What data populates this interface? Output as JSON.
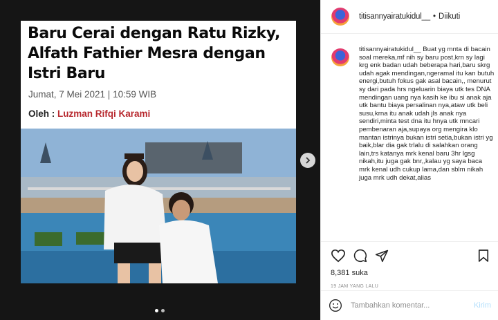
{
  "post": {
    "article": {
      "headline": "Baru Cerai dengan Ratu Rizky, Alfath Fathier Mesra dengan Istri Baru",
      "date": "Jumat, 7 Mei 2021 | 10:59 WIB",
      "byline_label": "Oleh :",
      "byline_author": "Luzman Rifqi Karami",
      "author_color": "#b7282e"
    },
    "carousel": {
      "current": 1,
      "total": 2
    }
  },
  "header": {
    "username": "titisannyairatukidul__",
    "separator": "•",
    "follow_status": "Diikuti"
  },
  "caption": {
    "username": "titisannyairatukidul__",
    "text": "Buat yg mnta di bacain soal mereka,mf nih sy baru post,krn sy lagi krg enk badan udah beberapa hari,baru skrg udah agak mendingan,ngeramal itu kan butuh energi,butuh fokus gak asal bacain,, menurut sy dari pada hrs ngeluarin biaya utk tes DNA mendingan uang nya kasih ke ibu si anak aja utk bantu biaya persalinan nya,ataw utk beli susu,krna itu anak udah jls anak nya sendiri,minta test dna itu hnya utk mncari pembenaran aja,supaya org mengira klo mantan istrinya bukan istri setia,bukan istri yg baik,blar dia gak trlalu di salahkan orang lain,trs katanya mrk kenal baru 3hr lgsg nikah,itu juga gak bnr,,kalau yg saya baca mrk kenal udh cukup lama,dan sblm nikah juga mrk udh dekat,alias"
  },
  "footer": {
    "likes": "8,381 suka",
    "timestamp": "19 JAM YANG LALU"
  },
  "comment_box": {
    "placeholder": "Tambahkan komentar...",
    "send_label": "Kirim"
  },
  "icons": {
    "like": "heart-icon",
    "comment": "comment-icon",
    "share": "share-icon",
    "save": "bookmark-icon",
    "emoji": "emoji-icon",
    "next": "chevron-right-icon"
  }
}
